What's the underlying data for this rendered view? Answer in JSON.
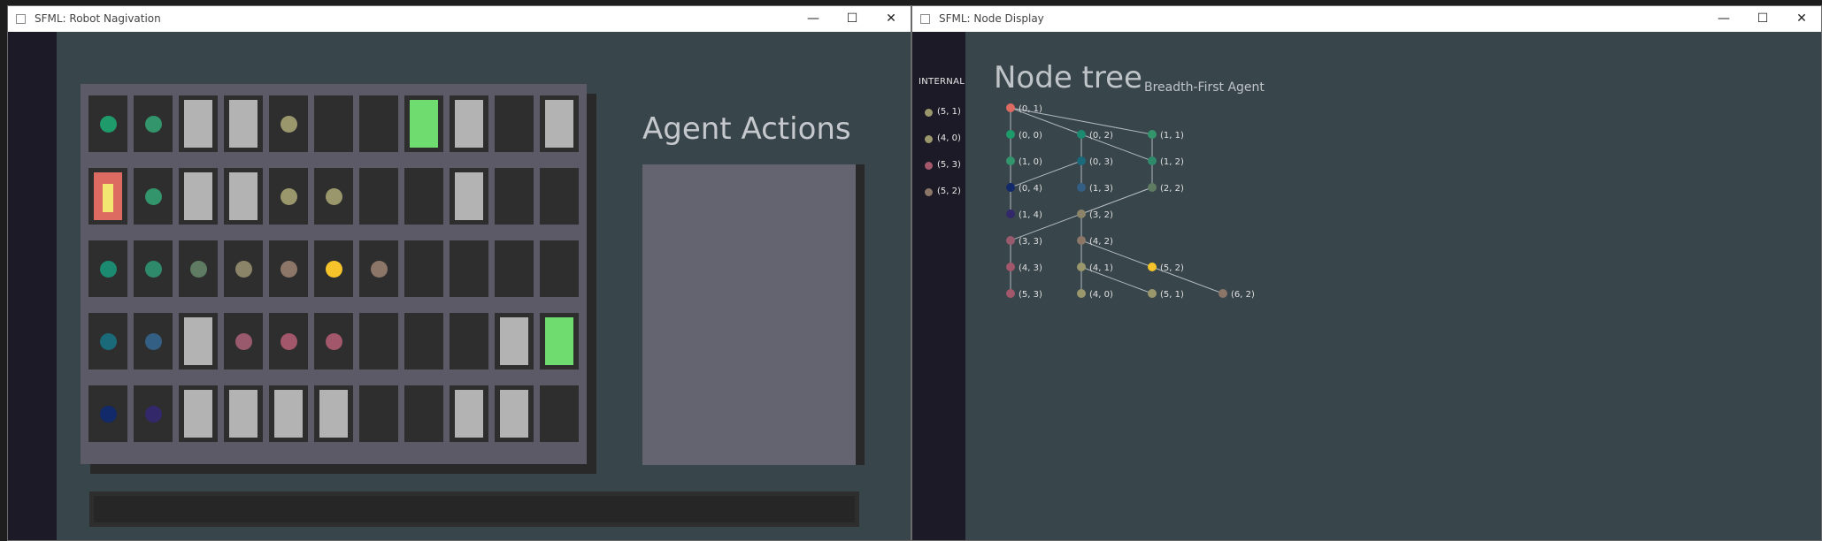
{
  "colors": {
    "green_cell": "#6fdc70",
    "block_cell": "#b3b3b3",
    "empty_cell": "#2e2e2e",
    "agent_outer": "#dd6b62",
    "agent_inner": "#f2e771",
    "background": "#38454b",
    "sidebar": "#1b1a26",
    "grid_panel": "#5b5a66",
    "actions_panel": "#646470",
    "edge": "#b0b8bc"
  },
  "robot_window": {
    "title": "SFML: Robot Nagivation",
    "controls": {
      "minimize": "—",
      "maximize": "☐",
      "close": "✕"
    },
    "agent_actions_title": "Agent Actions",
    "grid": {
      "rows": 5,
      "cols": 11,
      "cells": [
        [
          {
            "t": "dot",
            "c": "#1e9a6b"
          },
          {
            "t": "dot",
            "c": "#33956b"
          },
          {
            "t": "block"
          },
          {
            "t": "block"
          },
          {
            "t": "dot",
            "c": "#9b976c"
          },
          {
            "t": "empty"
          },
          {
            "t": "empty"
          },
          {
            "t": "green"
          },
          {
            "t": "block"
          },
          {
            "t": "empty"
          },
          {
            "t": "block"
          }
        ],
        [
          {
            "t": "agent"
          },
          {
            "t": "dot",
            "c": "#33956b"
          },
          {
            "t": "block"
          },
          {
            "t": "block"
          },
          {
            "t": "dot",
            "c": "#9b976c"
          },
          {
            "t": "dot",
            "c": "#9b976c"
          },
          {
            "t": "empty"
          },
          {
            "t": "empty"
          },
          {
            "t": "block"
          },
          {
            "t": "empty"
          },
          {
            "t": "empty"
          }
        ],
        [
          {
            "t": "dot",
            "c": "#1b8a70"
          },
          {
            "t": "dot",
            "c": "#2f8a6c"
          },
          {
            "t": "dot",
            "c": "#5f7c63"
          },
          {
            "t": "dot",
            "c": "#8c8468"
          },
          {
            "t": "dot",
            "c": "#8c7668"
          },
          {
            "t": "dot",
            "c": "#f6c42a"
          },
          {
            "t": "dot",
            "c": "#8c7668"
          },
          {
            "t": "empty"
          },
          {
            "t": "empty"
          },
          {
            "t": "empty"
          },
          {
            "t": "empty"
          }
        ],
        [
          {
            "t": "dot",
            "c": "#1b6a7a"
          },
          {
            "t": "dot",
            "c": "#345f84"
          },
          {
            "t": "block"
          },
          {
            "t": "dot",
            "c": "#9a5a6e"
          },
          {
            "t": "dot",
            "c": "#a3576a"
          },
          {
            "t": "dot",
            "c": "#a3576a"
          },
          {
            "t": "empty"
          },
          {
            "t": "empty"
          },
          {
            "t": "empty"
          },
          {
            "t": "block"
          },
          {
            "t": "green"
          }
        ],
        [
          {
            "t": "dot",
            "c": "#12296a"
          },
          {
            "t": "dot",
            "c": "#33286a"
          },
          {
            "t": "block"
          },
          {
            "t": "block"
          },
          {
            "t": "block"
          },
          {
            "t": "block"
          },
          {
            "t": "empty"
          },
          {
            "t": "empty"
          },
          {
            "t": "block"
          },
          {
            "t": "block"
          },
          {
            "t": "empty"
          }
        ]
      ]
    }
  },
  "node_window": {
    "title": "SFML: Node Display",
    "controls": {
      "minimize": "—",
      "maximize": "☐",
      "close": "✕"
    },
    "internal_label": "INTERNAL",
    "internal_items": [
      {
        "label": "(5, 1)",
        "color": "#9b976c"
      },
      {
        "label": "(4, 0)",
        "color": "#9b976c"
      },
      {
        "label": "(5, 3)",
        "color": "#a3576a"
      },
      {
        "label": "(5, 2)",
        "color": "#8c7668"
      }
    ],
    "tree_title": "Node tree",
    "tree_subtitle": "Breadth-First Agent",
    "tree": {
      "nodes": [
        {
          "id": "n01",
          "label": "(0, 1)",
          "color": "#dd6b62",
          "col": 0,
          "row": 0
        },
        {
          "id": "n00",
          "label": "(0, 0)",
          "color": "#1e9a6b",
          "col": 0,
          "row": 1
        },
        {
          "id": "n02",
          "label": "(0, 2)",
          "color": "#1b8a70",
          "col": 1,
          "row": 1
        },
        {
          "id": "n11",
          "label": "(1, 1)",
          "color": "#33956b",
          "col": 2,
          "row": 1
        },
        {
          "id": "n10",
          "label": "(1, 0)",
          "color": "#33956b",
          "col": 0,
          "row": 2
        },
        {
          "id": "n03",
          "label": "(0, 3)",
          "color": "#1b6a7a",
          "col": 1,
          "row": 2
        },
        {
          "id": "n12",
          "label": "(1, 2)",
          "color": "#2f8a6c",
          "col": 2,
          "row": 2
        },
        {
          "id": "n04",
          "label": "(0, 4)",
          "color": "#12296a",
          "col": 0,
          "row": 3
        },
        {
          "id": "n13",
          "label": "(1, 3)",
          "color": "#345f84",
          "col": 1,
          "row": 3
        },
        {
          "id": "n22",
          "label": "(2, 2)",
          "color": "#5f7c63",
          "col": 2,
          "row": 3
        },
        {
          "id": "n14",
          "label": "(1, 4)",
          "color": "#33286a",
          "col": 0,
          "row": 4
        },
        {
          "id": "n32",
          "label": "(3, 2)",
          "color": "#8c8468",
          "col": 1,
          "row": 4
        },
        {
          "id": "n33",
          "label": "(3, 3)",
          "color": "#9a5a6e",
          "col": 0,
          "row": 5
        },
        {
          "id": "n42",
          "label": "(4, 2)",
          "color": "#8c7668",
          "col": 1,
          "row": 5
        },
        {
          "id": "n43",
          "label": "(4, 3)",
          "color": "#a3576a",
          "col": 0,
          "row": 6
        },
        {
          "id": "n41",
          "label": "(4, 1)",
          "color": "#9b976c",
          "col": 1,
          "row": 6
        },
        {
          "id": "n52",
          "label": "(5, 2)",
          "color": "#f6c42a",
          "col": 2,
          "row": 6
        },
        {
          "id": "n53",
          "label": "(5, 3)",
          "color": "#a3576a",
          "col": 0,
          "row": 7
        },
        {
          "id": "n40",
          "label": "(4, 0)",
          "color": "#9b976c",
          "col": 1,
          "row": 7
        },
        {
          "id": "n51",
          "label": "(5, 1)",
          "color": "#9b976c",
          "col": 2,
          "row": 7
        },
        {
          "id": "n62",
          "label": "(6, 2)",
          "color": "#8c7668",
          "col": 3,
          "row": 7
        }
      ],
      "edges": [
        [
          "n01",
          "n00"
        ],
        [
          "n01",
          "n02"
        ],
        [
          "n01",
          "n11"
        ],
        [
          "n00",
          "n10"
        ],
        [
          "n02",
          "n03"
        ],
        [
          "n02",
          "n12"
        ],
        [
          "n11",
          "n12"
        ],
        [
          "n10",
          "n04"
        ],
        [
          "n03",
          "n04"
        ],
        [
          "n03",
          "n13"
        ],
        [
          "n12",
          "n22"
        ],
        [
          "n04",
          "n14"
        ],
        [
          "n22",
          "n32"
        ],
        [
          "n22",
          "n33"
        ],
        [
          "n32",
          "n42"
        ],
        [
          "n33",
          "n43"
        ],
        [
          "n42",
          "n41"
        ],
        [
          "n42",
          "n52"
        ],
        [
          "n43",
          "n53"
        ],
        [
          "n41",
          "n40"
        ],
        [
          "n41",
          "n51"
        ],
        [
          "n52",
          "n62"
        ]
      ]
    }
  }
}
